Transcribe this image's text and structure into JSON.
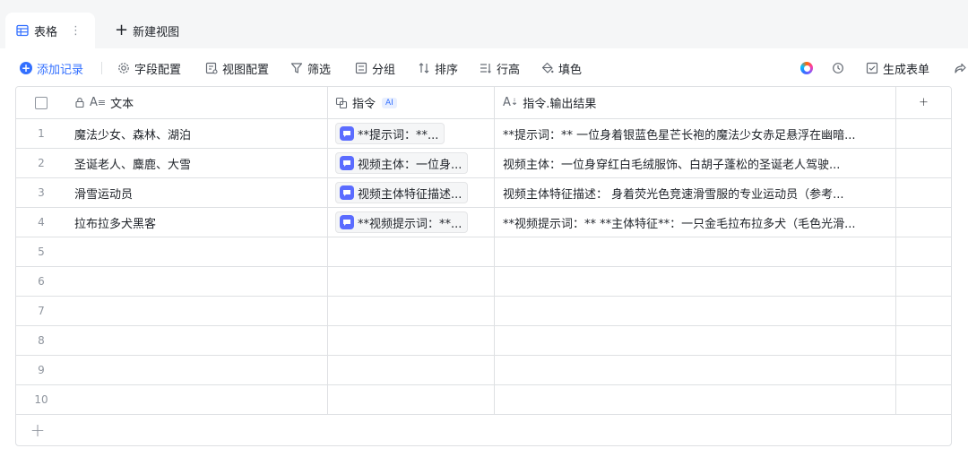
{
  "tabs": {
    "active_label": "表格",
    "more": "⋮",
    "new_view": "新建视图"
  },
  "toolbar": {
    "add_record": "添加记录",
    "field_config": "字段配置",
    "view_config": "视图配置",
    "filter": "筛选",
    "group": "分组",
    "sort": "排序",
    "row_height": "行高",
    "fill": "填色",
    "generate_form": "生成表单"
  },
  "table": {
    "columns": [
      {
        "label": "文本",
        "icon": "text-field-icon",
        "locked": true
      },
      {
        "label": "指令",
        "icon": "ai-command-icon",
        "badge": "AI"
      },
      {
        "label": "指令.输出结果",
        "icon": "ai-text-output-icon"
      }
    ],
    "rows": [
      {
        "index": "1",
        "text": "魔法少女、森林、湖泊",
        "command": "**提示词：**...",
        "output": "**提示词：** 一位身着银蓝色星芒长袍的魔法少女赤足悬浮在幽暗..."
      },
      {
        "index": "2",
        "text": "圣诞老人、麋鹿、大雪",
        "command": "视频主体：一位身...",
        "output": "视频主体：一位身穿红白毛绒服饰、白胡子蓬松的圣诞老人驾驶..."
      },
      {
        "index": "3",
        "text": "滑雪运动员",
        "command": "视频主体特征描述...",
        "output": "视频主体特征描述： 身着荧光色竞速滑雪服的专业运动员（参考..."
      },
      {
        "index": "4",
        "text": "拉布拉多犬黑客",
        "command": "**视频提示词：**...",
        "output": "**视频提示词：** **主体特征**：一只金毛拉布拉多犬（毛色光滑..."
      },
      {
        "index": "5",
        "text": "",
        "command": "",
        "output": ""
      },
      {
        "index": "6",
        "text": "",
        "command": "",
        "output": ""
      },
      {
        "index": "7",
        "text": "",
        "command": "",
        "output": ""
      },
      {
        "index": "8",
        "text": "",
        "command": "",
        "output": ""
      },
      {
        "index": "9",
        "text": "",
        "command": "",
        "output": ""
      },
      {
        "index": "10",
        "text": "",
        "command": "",
        "output": ""
      }
    ],
    "add_column": "+",
    "add_row": "+"
  },
  "colors": {
    "accent": "#3370ff",
    "chip_icon": "#5b6cff",
    "border": "#dee0e3",
    "muted": "#8f959e"
  }
}
